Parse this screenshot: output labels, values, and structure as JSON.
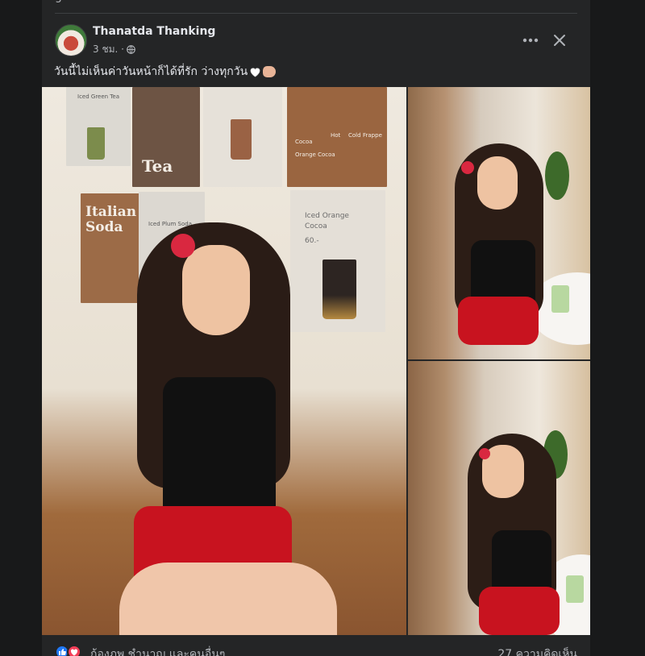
{
  "previous_post": {
    "fragment": "g"
  },
  "post": {
    "author": "Thanatda Thanking",
    "time": "3 ชม. ·",
    "caption": "วันนี้ไม่เห็นค่าวันหน้าก็ได้ที่รัก ว่างทุกวัน",
    "icons": {
      "privacy": "globe-icon",
      "more": "more-icon",
      "close": "close-icon",
      "heart_emoji": "white-heart-icon",
      "hand_emoji": "pointing-hand-icon"
    },
    "photos": {
      "main_posters": [
        "Tea",
        "Italian Soda",
        "Iced Orange Cocoa",
        "60.-"
      ],
      "poster_small": [
        "Iced Green Tea",
        "Iced Plum Soda",
        "Cocoa",
        "Orange Cocoa",
        "Hot",
        "Cold",
        "Frappe",
        "60"
      ]
    },
    "reactions": {
      "types": [
        "like-icon",
        "love-icon"
      ],
      "like_color": "#2078f4",
      "love_color": "#f33e58",
      "reactors_text": "ก้องภพ ชำนาญ และคนอื่นๆ",
      "comments_text": "27 ความคิดเห็น"
    }
  }
}
